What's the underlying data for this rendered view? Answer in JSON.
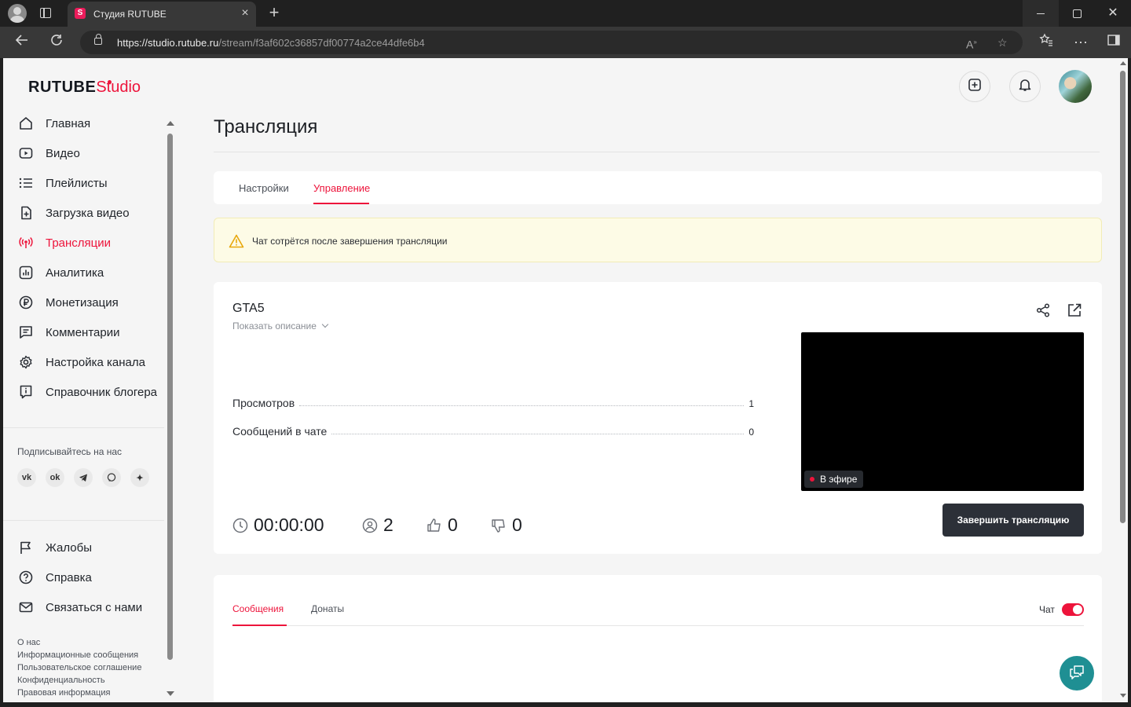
{
  "browser": {
    "tab_title": "Студия RUTUBE",
    "tab_favicon": "S",
    "url_host": "https://studio.rutube.ru",
    "url_path": "/stream/f3af602c36857df00774a2ce44dfe6b4"
  },
  "brand": {
    "logo_main": "RUTUBE",
    "logo_studio": "Studio",
    "accent_color": "#ed143b"
  },
  "sidebar": {
    "items": [
      {
        "label": "Главная",
        "icon": "home-icon"
      },
      {
        "label": "Видео",
        "icon": "video-icon"
      },
      {
        "label": "Плейлисты",
        "icon": "playlist-icon"
      },
      {
        "label": "Загрузка видео",
        "icon": "upload-icon"
      },
      {
        "label": "Трансляции",
        "icon": "broadcast-icon",
        "active": true
      },
      {
        "label": "Аналитика",
        "icon": "analytics-icon"
      },
      {
        "label": "Монетизация",
        "icon": "ruble-icon"
      },
      {
        "label": "Комментарии",
        "icon": "comment-icon"
      },
      {
        "label": "Настройка канала",
        "icon": "gear-icon"
      },
      {
        "label": "Справочник блогера",
        "icon": "info-icon"
      }
    ],
    "follow_label": "Подписывайтесь на нас",
    "socials": [
      "VK",
      "OK",
      "Telegram",
      "Viber",
      "Dzen"
    ],
    "secondary_items": [
      {
        "label": "Жалобы",
        "icon": "flag-icon"
      },
      {
        "label": "Справка",
        "icon": "help-icon"
      },
      {
        "label": "Связаться с нами",
        "icon": "mail-icon"
      }
    ],
    "footer_links": [
      "О нас",
      "Информационные сообщения",
      "Пользовательское соглашение",
      "Конфиденциальность",
      "Правовая информация"
    ]
  },
  "page": {
    "title": "Трансляция",
    "tabs": [
      "Настройки",
      "Управление"
    ],
    "active_tab": "Управление",
    "alert_text": "Чат сотрётся после завершения трансляции"
  },
  "stream": {
    "name": "GTA5",
    "show_description": "Показать описание",
    "stats": [
      {
        "label": "Просмотров",
        "value": "1"
      },
      {
        "label": "Сообщений в чате",
        "value": "0"
      }
    ],
    "live_label": "В эфире",
    "duration": "00:00:00",
    "viewers": "2",
    "likes": "0",
    "dislikes": "0",
    "end_button": "Завершить трансляцию"
  },
  "chat": {
    "tabs": [
      "Сообщения",
      "Донаты"
    ],
    "active_tab": "Сообщения",
    "toggle_label": "Чат",
    "toggle_on": true
  }
}
